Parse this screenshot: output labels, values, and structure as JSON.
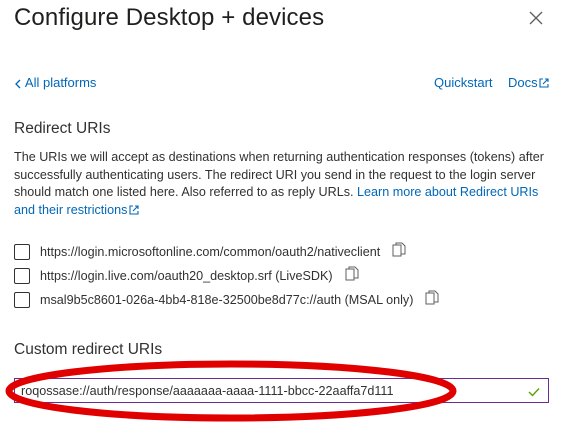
{
  "panel": {
    "title": "Configure Desktop + devices",
    "close_icon": "close-icon"
  },
  "nav": {
    "back_label": "All platforms",
    "quickstart_label": "Quickstart",
    "docs_label": "Docs"
  },
  "redirect_uris": {
    "heading": "Redirect URIs",
    "description": "The URIs we will accept as destinations when returning authentication responses (tokens) after successfully authenticating users. The redirect URI you send in the request to the login server should match one listed here. Also referred to as reply URLs.",
    "learn_more_label": "Learn more about Redirect URIs and their restrictions",
    "items": [
      {
        "uri": "https://login.microsoftonline.com/common/oauth2/nativeclient",
        "checked": false
      },
      {
        "uri": "https://login.live.com/oauth20_desktop.srf (LiveSDK)",
        "checked": false
      },
      {
        "uri": "msal9b5c8601-026a-4bb4-818e-32500be8d77c://auth (MSAL only)",
        "checked": false
      }
    ]
  },
  "custom_redirect": {
    "heading": "Custom redirect URIs",
    "value": "roqossase://auth/response/aaaaaaa-aaaa-1111-bbcc-22aaffa7d111",
    "valid": true
  },
  "colors": {
    "link": "#0067b8",
    "input_border": "#6b2d8f",
    "valid_check": "#57a300",
    "annotation": "#e00000"
  }
}
